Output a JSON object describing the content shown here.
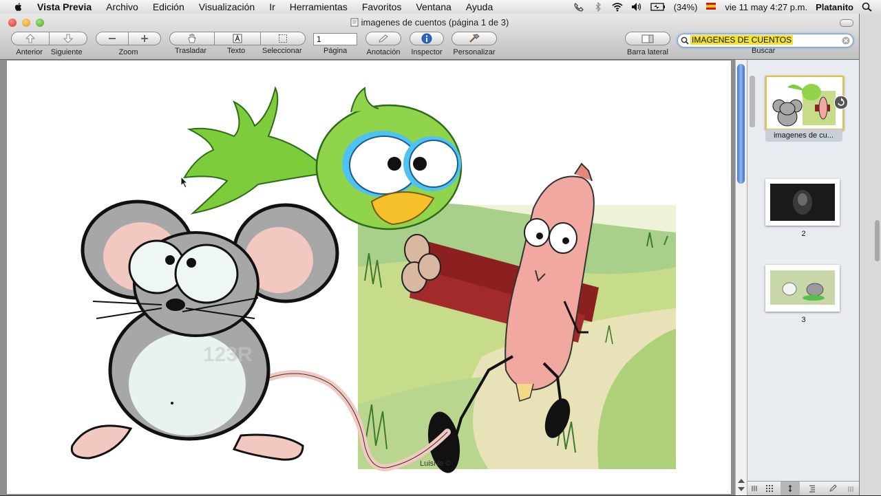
{
  "menubar": {
    "app": "Vista Previa",
    "items": [
      "Archivo",
      "Edición",
      "Visualización",
      "Ir",
      "Herramientas",
      "Favoritos",
      "Ventana",
      "Ayuda"
    ],
    "battery": "(34%)",
    "datetime": "vie 11 may  4:27 p.m.",
    "user": "Platanito"
  },
  "window": {
    "title": "imagenes de cuentos (página 1 de 3)"
  },
  "toolbar": {
    "anterior": "Anterior",
    "siguiente": "Siguiente",
    "zoom": "Zoom",
    "trasladar": "Trasladar",
    "texto": "Texto",
    "seleccionar": "Seleccionar",
    "pagina": "Página",
    "pagina_value": "1",
    "anotacion": "Anotación",
    "inspector": "Inspector",
    "personalizar": "Personalizar",
    "barra_lateral": "Barra lateral",
    "buscar": "Buscar",
    "search_value": "IMAGENES DE CUENTOS"
  },
  "document": {
    "watermark": "123R",
    "signature": "LuisNe ©"
  },
  "sidebar": {
    "thumbs": [
      {
        "label": "imagenes de cu..."
      },
      {
        "label": "2"
      },
      {
        "label": "3"
      }
    ]
  },
  "colors": {
    "search_highlight": "#f2e234",
    "scroll_accent": "#4a78c8"
  }
}
